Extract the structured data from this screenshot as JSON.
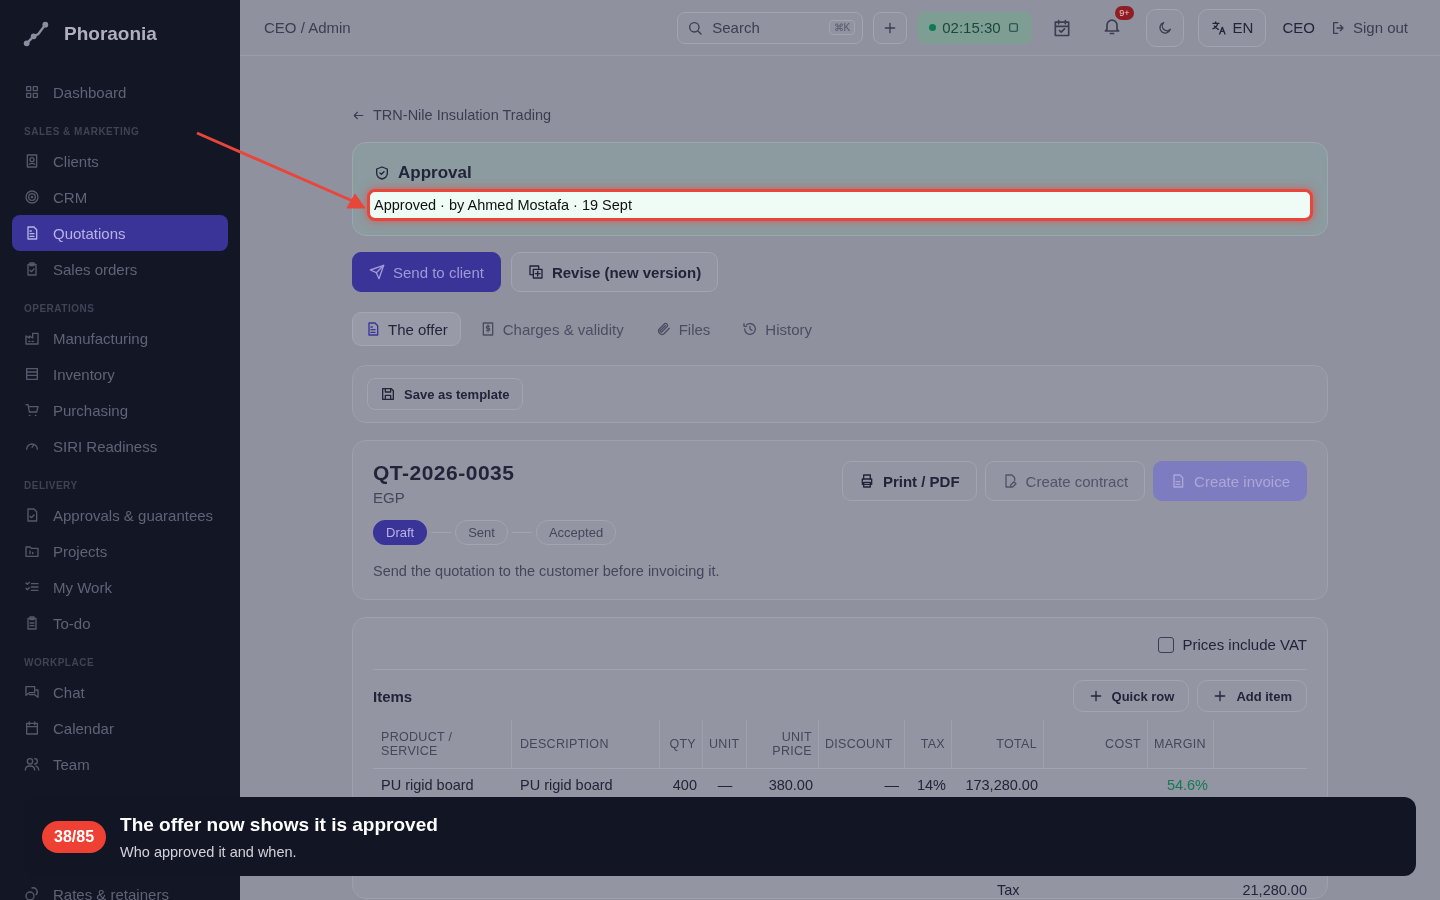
{
  "brand": "Phoraonia",
  "sidebar": {
    "sections": [
      {
        "items": [
          {
            "label": "Dashboard",
            "selected": false
          }
        ]
      },
      {
        "heading": "SALES & MARKETING",
        "items": [
          {
            "label": "Clients",
            "selected": false
          },
          {
            "label": "CRM",
            "selected": false
          },
          {
            "label": "Quotations",
            "selected": true
          },
          {
            "label": "Sales orders",
            "selected": false
          }
        ]
      },
      {
        "heading": "OPERATIONS",
        "items": [
          {
            "label": "Manufacturing",
            "selected": false
          },
          {
            "label": "Inventory",
            "selected": false
          },
          {
            "label": "Purchasing",
            "selected": false
          },
          {
            "label": "SIRI Readiness",
            "selected": false
          }
        ]
      },
      {
        "heading": "DELIVERY",
        "items": [
          {
            "label": "Approvals & guarantees",
            "selected": false
          },
          {
            "label": "Projects",
            "selected": false
          },
          {
            "label": "My Work",
            "selected": false
          },
          {
            "label": "To-do",
            "selected": false
          }
        ]
      },
      {
        "heading": "WORKPLACE",
        "items": [
          {
            "label": "Chat",
            "selected": false
          },
          {
            "label": "Calendar",
            "selected": false
          },
          {
            "label": "Team",
            "selected": false
          }
        ]
      }
    ],
    "footer_items": [
      {
        "label": "Rates & retainers",
        "selected": false
      }
    ]
  },
  "topbar": {
    "breadcrumb": "CEO / Admin",
    "search": {
      "placeholder": "Search",
      "shortcut": "⌘K"
    },
    "timer": "02:15:30",
    "notifications_badge": "9+",
    "language": "EN",
    "role": "CEO",
    "sign_out": "Sign out"
  },
  "back_link": "TRN-Nile Insulation Trading",
  "approval": {
    "title": "Approval",
    "status": "Approved · by Ahmed Mostafa · 19 Sept"
  },
  "actions": [
    {
      "label": "Send to client",
      "kind": "primary"
    },
    {
      "label": "Revise (new version)",
      "kind": "secondary"
    }
  ],
  "tabs": [
    {
      "label": "The offer",
      "selected": true
    },
    {
      "label": "Charges & validity",
      "selected": false
    },
    {
      "label": "Files",
      "selected": false
    },
    {
      "label": "History",
      "selected": false
    }
  ],
  "template_button": "Save as template",
  "quote": {
    "number": "QT-2026-0035",
    "currency": "EGP",
    "buttons": [
      {
        "label": "Print / PDF",
        "disabled": false,
        "kind": "print"
      },
      {
        "label": "Create contract",
        "disabled": true,
        "kind": "contract"
      },
      {
        "label": "Create invoice",
        "disabled": true,
        "kind": "invoice"
      }
    ],
    "stages": [
      {
        "label": "Draft",
        "selected": true
      },
      {
        "label": "Sent",
        "selected": false
      },
      {
        "label": "Accepted",
        "selected": false
      }
    ],
    "hint": "Send the quotation to the customer before invoicing it."
  },
  "items": {
    "prices_include_vat": {
      "label": "Prices include VAT",
      "checked": false
    },
    "title": "Items",
    "buttons": [
      "Quick row",
      "Add item"
    ],
    "columns": [
      "PRODUCT / SERVICE",
      "DESCRIPTION",
      "QTY",
      "UNIT",
      "UNIT PRICE",
      "DISCOUNT",
      "TAX",
      "TOTAL",
      "COST",
      "MARGIN"
    ],
    "rows": [
      [
        "PU rigid board",
        "PU rigid board",
        "400",
        "—",
        "380.00",
        "—",
        "14%",
        "173,280.00",
        "",
        "54.6%"
      ]
    ],
    "totals": [
      {
        "label": "Tax",
        "value": "21,280.00"
      }
    ]
  },
  "tour": {
    "step": "38/85",
    "title": "The offer now shows it is approved",
    "text": "Who approved it and when."
  }
}
